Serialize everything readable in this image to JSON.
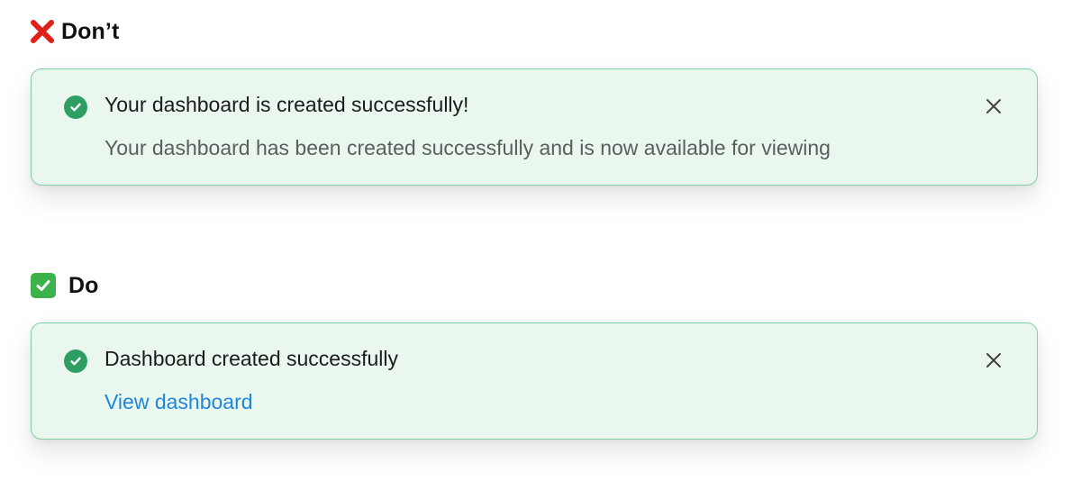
{
  "colors": {
    "toast_background": "#e9f7ef",
    "toast_border": "#7fd0a4",
    "success_icon": "#2e9e62",
    "link": "#1f86d8",
    "dont_mark": "#e0201b",
    "do_mark": "#3bb34a"
  },
  "dont_section": {
    "icon": "red-x-icon",
    "label": "Don’t",
    "toast": {
      "icon": "check-circle-icon",
      "title": "Your dashboard is created successfully!",
      "description": "Your dashboard has been created successfully and is now available for viewing",
      "close_icon": "close-icon"
    }
  },
  "do_section": {
    "icon": "green-checkbox-icon",
    "label": "Do",
    "toast": {
      "icon": "check-circle-icon",
      "title": "Dashboard created successfully",
      "link_label": "View dashboard",
      "close_icon": "close-icon"
    }
  }
}
